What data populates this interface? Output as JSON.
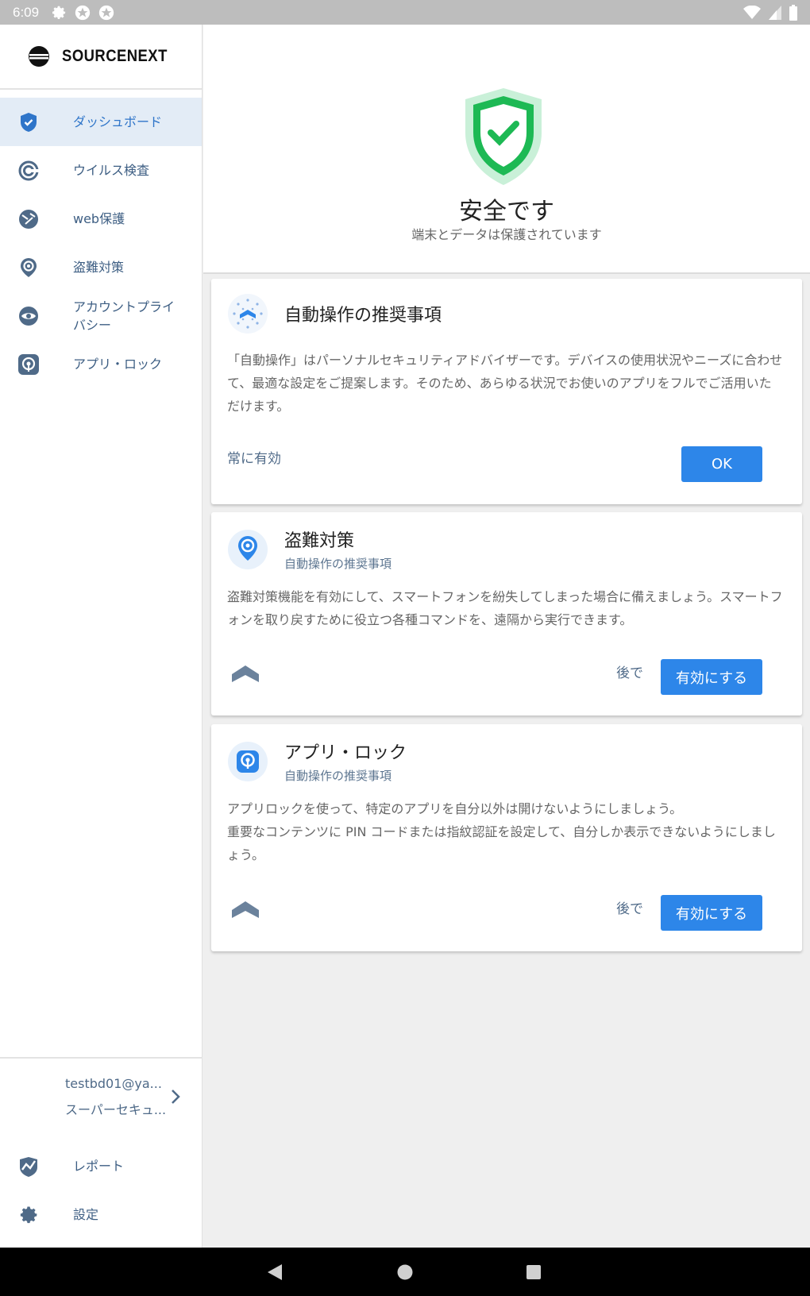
{
  "status_bar": {
    "time": "6:09"
  },
  "sidebar": {
    "logo": "SOURCENEXT",
    "items": [
      {
        "label": "ダッシュボード",
        "icon": "shield-check-icon",
        "active": true
      },
      {
        "label": "ウイルス検査",
        "icon": "scan-icon"
      },
      {
        "label": "web保護",
        "icon": "globe-icon"
      },
      {
        "label": "盗難対策",
        "icon": "location-pin-icon"
      },
      {
        "label": "アカウントプライバシー",
        "icon": "eye-icon"
      },
      {
        "label": "アプリ・ロック",
        "icon": "app-lock-icon"
      }
    ],
    "account": {
      "email": "testbd01@ya...",
      "plan": "スーパーセキュ..."
    },
    "bottom_items": [
      {
        "label": "レポート",
        "icon": "report-icon"
      },
      {
        "label": "設定",
        "icon": "gear-icon"
      }
    ]
  },
  "hero": {
    "title": "安全です",
    "subtitle": "端末とデータは保護されています"
  },
  "cards": [
    {
      "title": "自動操作の推奨事項",
      "body": "「自動操作」はパーソナルセキュリティアドバイザーです。デバイスの使用状況やニーズに合わせて、最適な設定をご提案します。そのため、あらゆる状況でお使いのアプリをフルでご活用いただけます。",
      "secondary": "常に有効",
      "primary": "OK"
    },
    {
      "title": "盗難対策",
      "subtitle": "自動操作の推奨事項",
      "body": "盗難対策機能を有効にして、スマートフォンを紛失してしまった場合に備えましょう。スマートフォンを取り戻すために役立つ各種コマンドを、遠隔から実行できます。",
      "secondary": "後で",
      "primary": "有効にする"
    },
    {
      "title": "アプリ・ロック",
      "subtitle": "自動操作の推奨事項",
      "body_line1": "アプリロックを使って、特定のアプリを自分以外は開けないようにしましょう。",
      "body_line2": "重要なコンテンツに PIN コードまたは指紋認証を設定して、自分しか表示できないようにしましょう。",
      "secondary": "後で",
      "primary": "有効にする"
    }
  ],
  "colors": {
    "accent": "#2d86e9",
    "safe": "#1db954",
    "nav_text": "#3d5e83"
  }
}
